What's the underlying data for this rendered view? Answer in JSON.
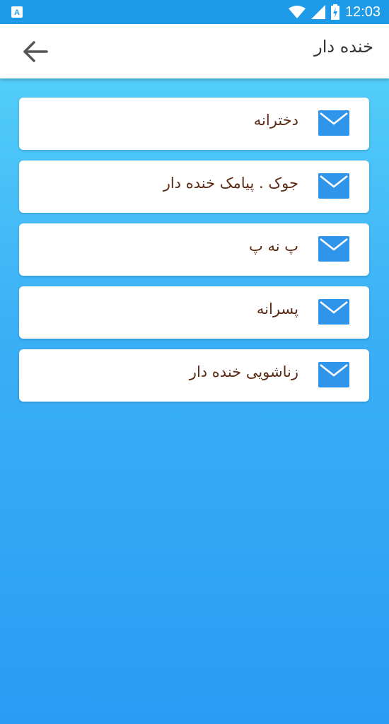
{
  "status_bar": {
    "time": "12:03",
    "icons": [
      "a-notification-icon",
      "wifi-icon",
      "signal-icon",
      "battery-icon"
    ]
  },
  "app_bar": {
    "title": "خنده دار",
    "back_icon": "arrow-left-icon"
  },
  "colors": {
    "status_bar": "#1e9be8",
    "gradient_top": "#5ad6f9",
    "gradient_bottom": "#2a9cf4",
    "mail_icon": "#2e95ea",
    "label_text": "#5a2a14"
  },
  "categories": [
    {
      "label": "دخترانه",
      "icon": "mail-icon"
    },
    {
      "label": "جوک . پیامک خنده دار",
      "icon": "mail-icon"
    },
    {
      "label": "پ نه پ",
      "icon": "mail-icon"
    },
    {
      "label": "پسرانه",
      "icon": "mail-icon"
    },
    {
      "label": "زناشویی خنده دار",
      "icon": "mail-icon"
    }
  ]
}
